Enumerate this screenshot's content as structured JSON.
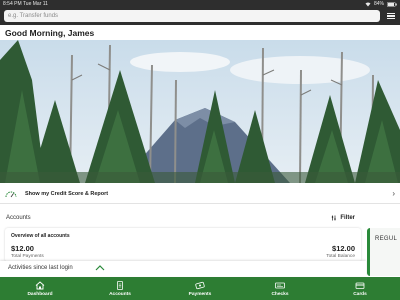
{
  "status_bar": {
    "time": "8:54 PM",
    "date": "Tue Mar 11",
    "battery": "84%"
  },
  "search": {
    "placeholder": "e.g. Transfer funds"
  },
  "greeting": "Good Morning, James",
  "credit_score": {
    "label": "Show my Credit Score & Report"
  },
  "accounts": {
    "title": "Accounts",
    "filter_label": "Filter",
    "overview_label": "Overview of all accounts",
    "total_payments_amount": "$12.00",
    "total_payments_label": "Total Payments",
    "total_balance_amount": "$12.00",
    "total_balance_label": "Total Balance",
    "regular_card_label": "REGUL"
  },
  "activities": {
    "label": "Activities since last login"
  },
  "bottom_nav": {
    "items": [
      {
        "label": "Dashboard",
        "icon": "home-icon"
      },
      {
        "label": "Accounts",
        "icon": "document-icon"
      },
      {
        "label": "Payments",
        "icon": "money-icon"
      },
      {
        "label": "Checks",
        "icon": "check-icon"
      },
      {
        "label": "Cards",
        "icon": "card-icon"
      }
    ]
  },
  "colors": {
    "header_bg": "#2e2e2e",
    "nav_green": "#2d7d33",
    "accent_green": "#2a8a3a"
  }
}
